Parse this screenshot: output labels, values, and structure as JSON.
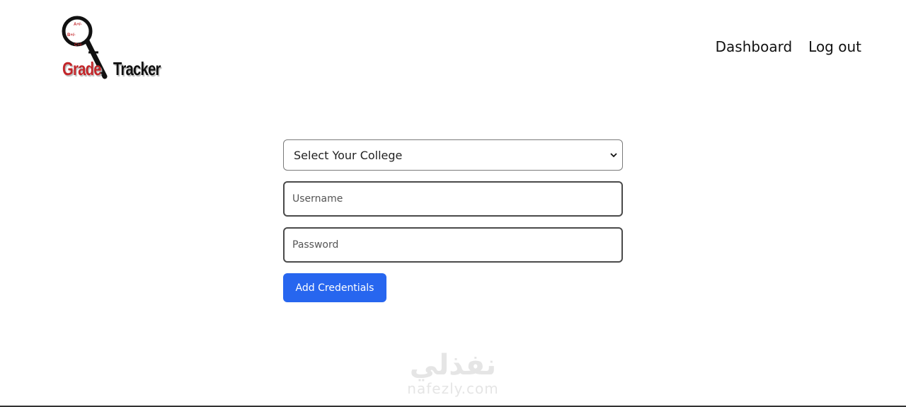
{
  "logo": {
    "grade": "Grade",
    "tracker": "Tracker",
    "grades": [
      "A+/-",
      "B+/-",
      "C+/-"
    ]
  },
  "nav": {
    "dashboard": "Dashboard",
    "logout": "Log out"
  },
  "form": {
    "college_select": "Select Your College",
    "username_placeholder": "Username",
    "password_placeholder": "Password",
    "submit_label": "Add Credentials"
  },
  "watermark": {
    "arabic": "نفذلي",
    "latin": "nafezly.com"
  },
  "colors": {
    "primary": "#2766ef",
    "logo_red": "#c3262a"
  }
}
